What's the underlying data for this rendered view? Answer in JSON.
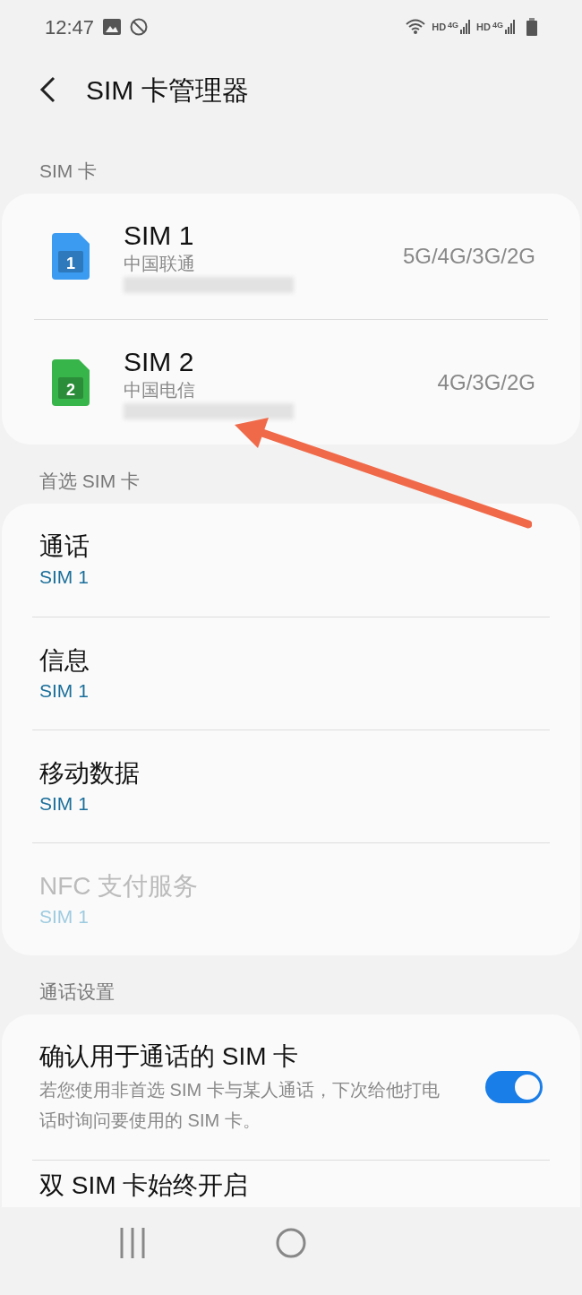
{
  "status_bar": {
    "time": "12:47",
    "hd_1": "HD",
    "network_1": "4G",
    "hd_2": "HD",
    "network_2": "4G"
  },
  "header": {
    "title": "SIM 卡管理器"
  },
  "sim_section": {
    "heading": "SIM 卡",
    "cards": [
      {
        "name": "SIM 1",
        "badge": "1",
        "color": "#3a9bf0",
        "carrier": "中国联通",
        "networks": "5G/4G/3G/2G"
      },
      {
        "name": "SIM 2",
        "badge": "2",
        "color": "#38b54a",
        "carrier": "中国电信",
        "networks": "4G/3G/2G"
      }
    ]
  },
  "preferred_section": {
    "heading": "首选 SIM 卡",
    "items": [
      {
        "label": "通话",
        "value": "SIM 1",
        "disabled": false
      },
      {
        "label": "信息",
        "value": "SIM 1",
        "disabled": false
      },
      {
        "label": "移动数据",
        "value": "SIM 1",
        "disabled": false
      },
      {
        "label": "NFC 支付服务",
        "value": "SIM 1",
        "disabled": true
      }
    ]
  },
  "call_settings": {
    "heading": "通话设置",
    "items": [
      {
        "kind": "toggle",
        "title": "确认用于通话的 SIM 卡",
        "description": "若您使用非首选 SIM 卡与某人通话，下次给他打电话时询问要使用的 SIM 卡。",
        "on": true
      },
      {
        "kind": "plain",
        "title": "双 SIM 卡始终开启"
      }
    ]
  }
}
